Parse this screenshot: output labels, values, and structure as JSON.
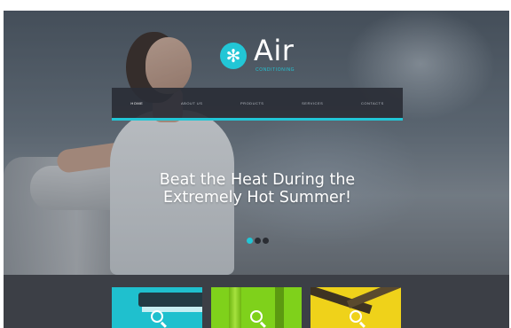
{
  "logo": {
    "icon": "snowflake-icon",
    "glyph": "✻",
    "name": "Air",
    "subtitle": "CONDITIONING"
  },
  "nav": {
    "items": [
      {
        "label": "HOME",
        "active": true
      },
      {
        "label": "ABOUT US",
        "active": false
      },
      {
        "label": "PRODUCTS",
        "active": false
      },
      {
        "label": "SERVICES",
        "active": false
      },
      {
        "label": "CONTACTS",
        "active": false
      }
    ]
  },
  "hero": {
    "headline_line1": "Beat the Heat During the",
    "headline_line2": "Extremely Hot Summer!"
  },
  "slider": {
    "dots": 3,
    "active_index": 0
  },
  "tiles": [
    {
      "name": "air-conditioner-tile",
      "color": "#1fc0ce",
      "icon": "magnifier-icon"
    },
    {
      "name": "column-fan-tile",
      "color": "#7fd11b",
      "icon": "magnifier-icon"
    },
    {
      "name": "ceiling-fan-tile",
      "color": "#efd21a",
      "icon": "magnifier-icon"
    }
  ],
  "colors": {
    "accent": "#22c6d6",
    "nav_bg": "#2a2e36",
    "footer_bg": "#3c3f46"
  }
}
